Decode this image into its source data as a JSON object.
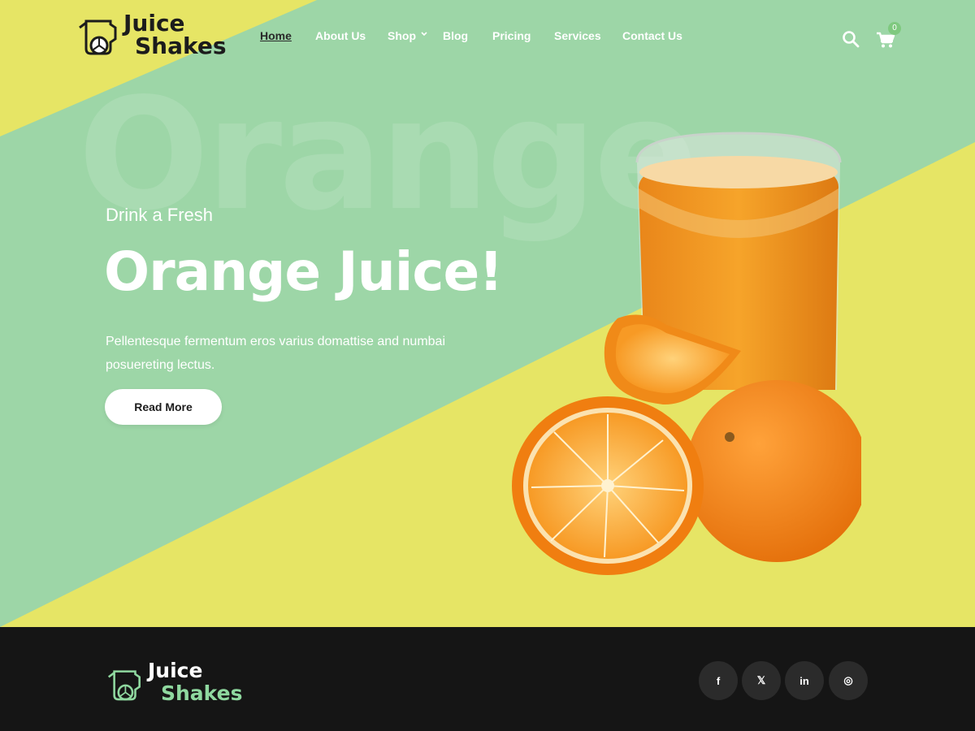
{
  "header": {
    "logo": {
      "line1": "Juice",
      "line2": "Shakes"
    },
    "nav": [
      {
        "label": "Home",
        "active": true
      },
      {
        "label": "About Us"
      },
      {
        "label": "Shop",
        "has_dropdown": true
      },
      {
        "label": "Blog"
      },
      {
        "label": "Pricing"
      },
      {
        "label": "Services"
      },
      {
        "label": "Contact Us"
      }
    ],
    "icons": {
      "search": "search-icon",
      "cart": "cart-icon"
    },
    "cart_count": "0"
  },
  "hero": {
    "background_word": "Orange",
    "subtitle": "Drink a Fresh",
    "title": "Orange Juice!",
    "description": "Pellentesque fermentum eros varius domattise and numbai posuereting lectus.",
    "button_label": "Read More"
  },
  "footer": {
    "logo": {
      "line1": "Juice",
      "line2": "Shakes"
    },
    "social": [
      {
        "glyph": "f",
        "icon": "facebook-icon"
      },
      {
        "glyph": "𝕏",
        "icon": "x-twitter-icon"
      },
      {
        "glyph": "in",
        "icon": "linkedin-icon"
      },
      {
        "glyph": "◎",
        "icon": "instagram-icon"
      }
    ]
  },
  "colors": {
    "mint": "#9dd6a7",
    "yellow": "#e6e565",
    "footer_bg": "#151515",
    "social_bg": "#2b2b2b",
    "logo_green": "#8fd89f"
  }
}
